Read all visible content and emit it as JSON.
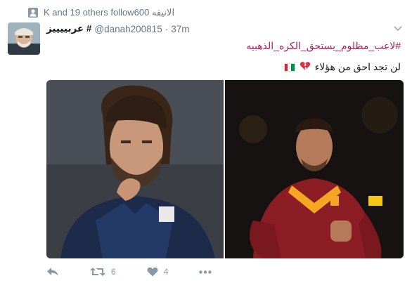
{
  "context": {
    "text": "K and 19 others followالانيقه 600"
  },
  "header": {
    "name": "عربييييز #",
    "handle": "@danah200815",
    "separator": "·",
    "time": "37m"
  },
  "tweet": {
    "hashtag": "#لاعب_مظلوم_يستحق_الكره_الذهبيه",
    "text": "لن تجد احق من هؤلاء",
    "emoji": [
      "broken-heart-icon",
      "italy-flag-icon"
    ]
  },
  "media": {
    "left_photo": "footballer-italy-kit-photo",
    "right_photo": "footballer-roma-kit-photo"
  },
  "actions": {
    "retweet_count": "6",
    "like_count": "4"
  },
  "colors": {
    "hashtag": "#b0185a",
    "meta": "#657786",
    "icon": "#8899a6"
  }
}
